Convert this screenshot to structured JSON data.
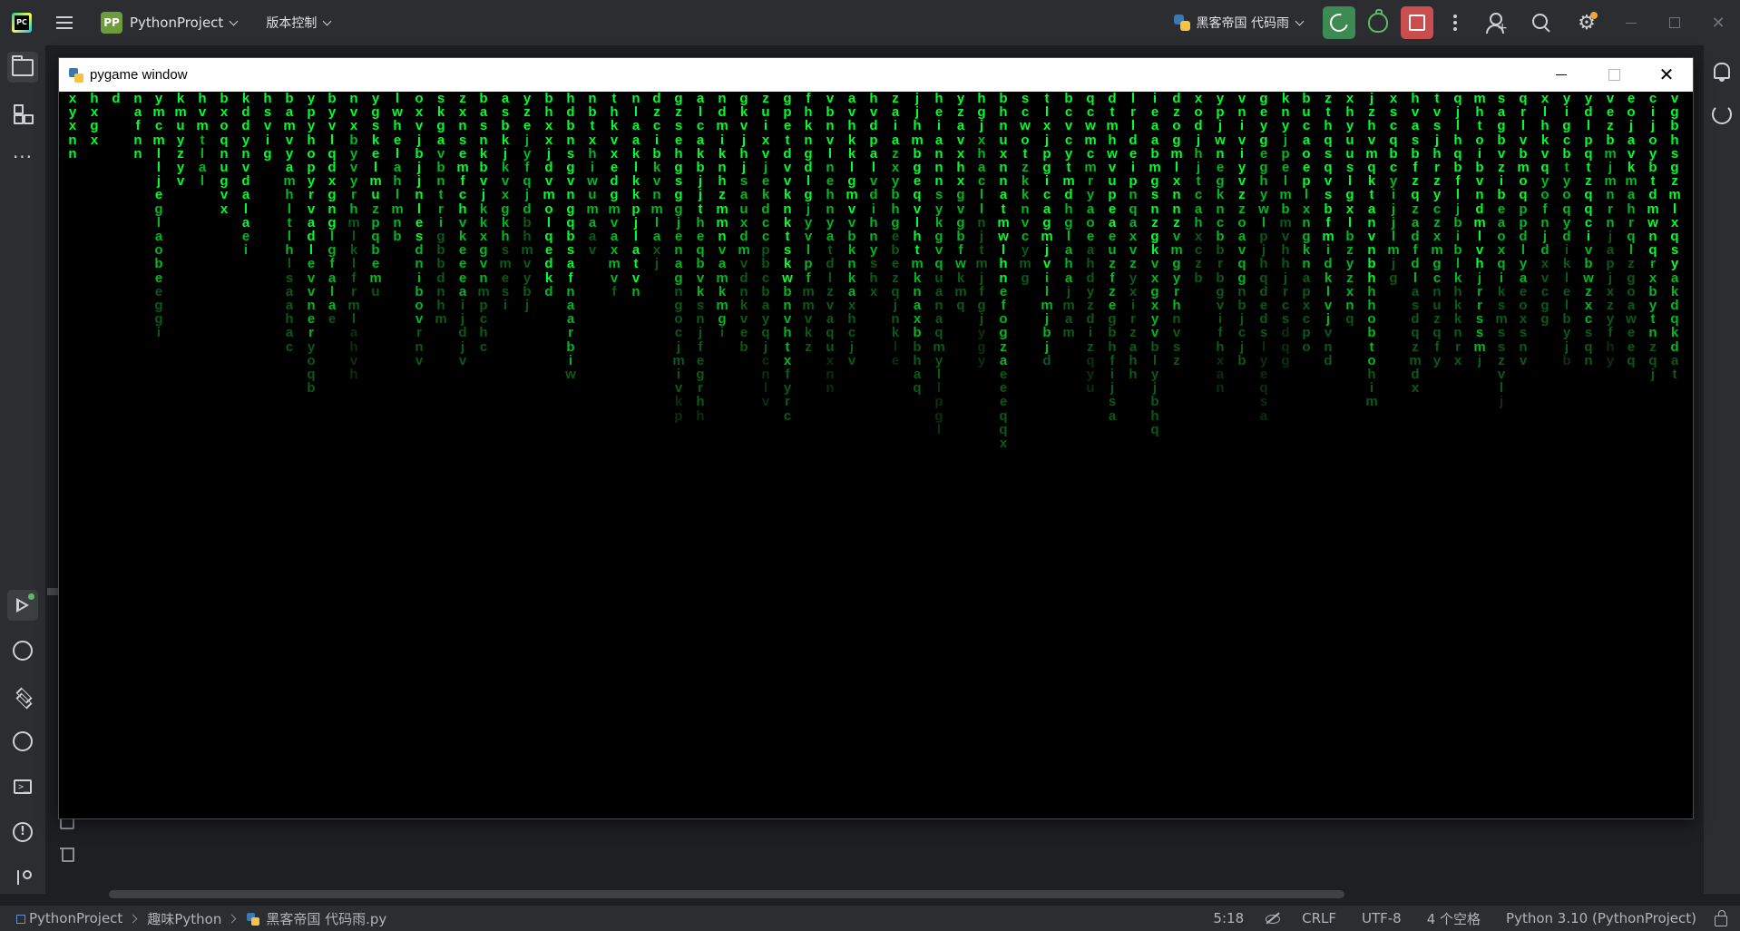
{
  "titlebar": {
    "project_badge": "PP",
    "project_name": "PythonProject",
    "vcs_label": "版本控制",
    "run_config": "黑客帝国 代码雨"
  },
  "pygame_window": {
    "title": "pygame window",
    "rain_columns": [
      "xyxnn",
      "hxgx",
      "d",
      "nafnn",
      "ymcmlljeglaobeeggi",
      "kmuyzyv",
      "hvmtlal",
      "bxoqnugvx",
      "kddynvdalaei",
      "hsvig",
      "bamvyamhltlhlsaahac",
      "ypyhopyrvadlevvneryoqb",
      "byvlqdxgnglgfalae",
      "nvxbyvyrhmlklfrmlahvh",
      "ygskelmuzpqbemu",
      "lwhelahlmnb",
      "oxvjbjjnlesdnibovrnv",
      "skgavbntrigbbdnhm",
      "zxnsemfchvkeeeaijdjv",
      "basnkbvjkkxgvnmpchc",
      "asbkjkvxgkhsmesi",
      "yzejyfqjdbhmvybj",
      "bhxxjdvmolqedkd",
      "hdbnsgvngqbsafnaarbiw",
      "nbtxhiwumaav",
      "thkvxedgmvaxmvf",
      "nlaaklkkpjlatvn",
      "dzcibkvnmlaxj",
      "gzsehgsggjenagngocjmivkp",
      "alcakbjjtheqbvksnjfegrhh",
      "ndmiknhzmmnvamkmgi",
      "gkvjhjsauxdmvdnkveb",
      "zuixvjekdccpbcbayqjcnlv",
      "gpetdvvknktskwbnvhtxfyrc",
      "fhkngdlgjyvlpfmmvkz",
      "vbnvlnehnyatdlzvaquxnn",
      "avhkklgmvvbknkaxhcjv",
      "hvdpalvdihnyshx",
      "zaiazxybhgebezqjnkle",
      "jjhmbgeqvlhtmknaxbbhaq",
      "heiannnsykgvquanaqmyllpgl",
      "yzavxhxgvgbfwkmq",
      "hgjxhacllnjtmjfgjygy",
      "bhnuxnnatmwlhnefogzaeeeqqx",
      "scwotzkknvcymg",
      "tlxjpgicagmjvilmjbjd",
      "bcvcytmdhglahajmam",
      "qcwmcmryaoeahdyzdizqyu",
      "dtmhwvupeaeuzfzegbhfijsa",
      "lrldeipnqaxvzyxirzahh",
      "ieaabmgsnzgkvxgxyvblyjbhq",
      "dzogmlxnnzvmgyrhnvsz",
      "xodjhjtcahxczb",
      "ypjwnegkncbbrbgvifhxan",
      "vniviyvzzoavqgnbjcjb",
      "geygeghywlpjhqdedslyeqsa",
      "knyjpelmbmvhhjrcsdqg",
      "bucaoeplxngknapxcpo",
      "zthqsqvsbfmidklvjvnd",
      "xhyuuslgxlbzyzxnq",
      "jzhvmqktanvnbhhhobtohim",
      "xscqbcyijjlmjg",
      "hvasbfzqzadfdlasdqzmdx",
      "tvsjhrzyczxmgcnuzqfy",
      "qjlhqbfljbiblkhkknrx",
      "mhtoibvndmlvhjrrssmj",
      "sagbvzibeaoxqiksmsszvlj",
      "qrlvbmoqppdlyaeoxsnv",
      "xlhkvqyofnjdxvcgg",
      "yigcbtyoqydiklelbyjb",
      "ydlpqtzqqcivbwzxcsqn",
      "vezbmjmnrnjapjxzyfhy",
      "eojavkmahrqlzgoaweeq",
      "cijoybtdmwnqrxbytnzqj",
      "vgbhsgzmlxqsyakdqkdat"
    ]
  },
  "left_strip": {
    "items": [
      "project",
      "structure",
      "more",
      "run",
      "python-console",
      "services",
      "run-config",
      "terminal",
      "problems",
      "git"
    ]
  },
  "statusbar": {
    "crumbs": [
      "PythonProject",
      "趣味Python",
      "黑客帝国 代码雨.py"
    ],
    "position": "5:18",
    "line_sep": "CRLF",
    "encoding": "UTF-8",
    "indent": "4 个空格",
    "interpreter": "Python 3.10 (PythonProject)"
  },
  "colors": {
    "rain_bright": "#00ff2a",
    "rain_mid": "#00b81f",
    "rain_dim": "#0a5a14",
    "rain_faint": "#0a2f0f"
  }
}
